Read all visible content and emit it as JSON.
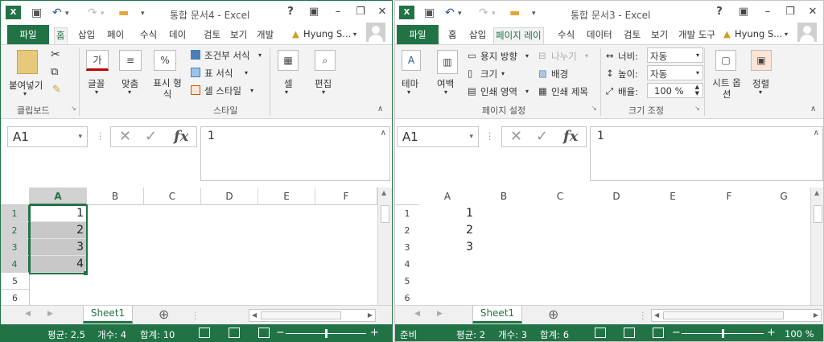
{
  "left": {
    "title": "통합 문서4 - Excel",
    "app_icon": "X",
    "help": "?",
    "tabs": [
      "파일",
      "홈",
      "삽입",
      "페이",
      "수식",
      "데이",
      "검토",
      "보기",
      "개발"
    ],
    "user": "Hyung S...",
    "ribbon": {
      "paste": "붙여넣기",
      "font": "글꼴",
      "align": "맞춤",
      "number": "표시 형식",
      "cond": "조건부 서식",
      "table": "표 서식",
      "cellstyle": "셀 스타일",
      "cells": "셀",
      "edit": "편집",
      "grp_clip": "클립보드",
      "grp_style": "스타일",
      "font_icon": "가",
      "percent": "%"
    },
    "namebox": "A1",
    "fx": "fx",
    "formula": "1",
    "cols": [
      "A",
      "B",
      "C",
      "D",
      "E",
      "F"
    ],
    "rows": [
      "1",
      "2",
      "3",
      "4",
      "5",
      "6"
    ],
    "cells": [
      "1",
      "2",
      "3",
      "4"
    ],
    "sheet": "Sheet1",
    "status": {
      "avg": "평균: 2.5",
      "count": "개수: 4",
      "sum": "합계: 10"
    }
  },
  "right": {
    "title": "통합 문서3 - Excel",
    "app_icon": "X",
    "help": "?",
    "tabs": [
      "파일",
      "홈",
      "삽입",
      "페이지 레이",
      "수식",
      "데이터",
      "검토",
      "보기",
      "개발 도구"
    ],
    "user": "Hyung S...",
    "ribbon": {
      "theme": "테마",
      "margin": "여백",
      "orient": "용지 방향",
      "size": "크기",
      "area": "인쇄 영역",
      "breaks": "나누기",
      "bg": "배경",
      "titles": "인쇄 제목",
      "width_l": "너비:",
      "width_v": "자동",
      "height_l": "높이:",
      "height_v": "자동",
      "scale_l": "배율:",
      "scale_v": "100 %",
      "sheetopt": "시트 옵션",
      "arrange": "정렬",
      "grp_page": "페이지 설정",
      "grp_fit": "크기 조정"
    },
    "namebox": "A1",
    "fx": "fx",
    "formula": "1",
    "cols": [
      "A",
      "B",
      "C",
      "D",
      "E",
      "F",
      "G"
    ],
    "rows": [
      "1",
      "2",
      "3",
      "4",
      "5",
      "6"
    ],
    "cells": [
      "1",
      "2",
      "3"
    ],
    "sheet": "Sheet1",
    "status": {
      "ready": "준비",
      "avg": "평균: 2",
      "count": "개수: 3",
      "sum": "합계: 6",
      "zoom": "100 %"
    }
  },
  "colors": {
    "accent": "#217346"
  }
}
